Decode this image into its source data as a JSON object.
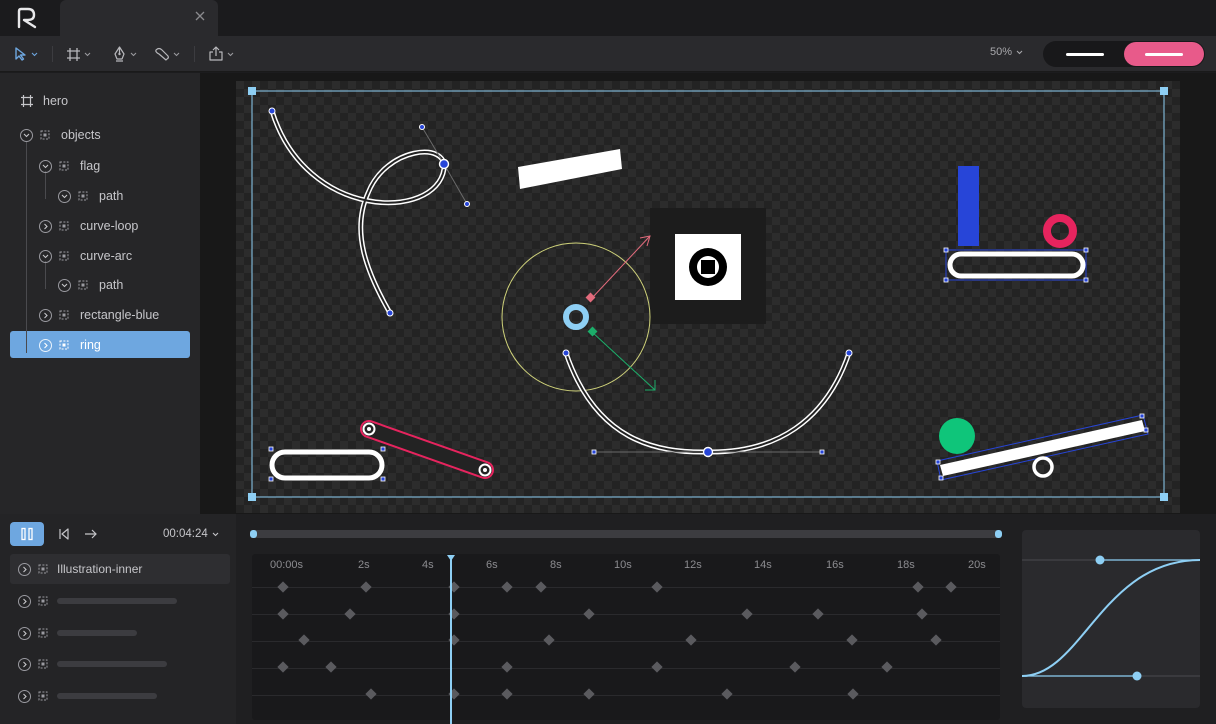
{
  "app": {
    "logo": "R"
  },
  "toolbar": {
    "zoom": "50%",
    "icons": [
      "select-arrow-icon",
      "frame-icon",
      "pen-icon",
      "brush-icon",
      "export-icon"
    ]
  },
  "layers": [
    {
      "label": "hero",
      "type": "frame"
    },
    {
      "label": "objects"
    },
    {
      "label": "flag"
    },
    {
      "label": "path"
    },
    {
      "label": "curve-loop"
    },
    {
      "label": "curve-arc"
    },
    {
      "label": "path"
    },
    {
      "label": "rectangle-blue"
    },
    {
      "label": "ring",
      "selected": true
    }
  ],
  "timeline": {
    "timecode": "00:04:24",
    "tracks": [
      {
        "label": "Illustration-inner"
      }
    ],
    "ticks": [
      "00:00s",
      "2s",
      "4s",
      "6s",
      "8s",
      "10s",
      "12s",
      "14s",
      "16s",
      "18s",
      "20s"
    ]
  },
  "colors": {
    "accent": "#6ea7e0",
    "pink": "#e85a8a",
    "playhead": "#8ecff4",
    "blue_shape": "#2745d8",
    "red_ring": "#e6245e",
    "green": "#0fc57a"
  }
}
